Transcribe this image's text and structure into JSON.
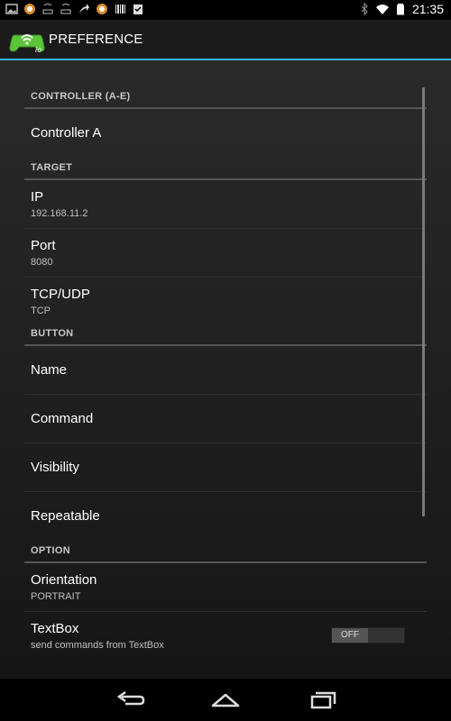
{
  "status_bar": {
    "time": "21:35",
    "icons_left": [
      "gallery-icon",
      "app-icon",
      "download-icon",
      "download-icon",
      "share-icon",
      "app-icon",
      "barcode-icon",
      "checklist-icon"
    ],
    "icons_right": [
      "bluetooth-icon",
      "wifi-icon",
      "battery-icon"
    ]
  },
  "action_bar": {
    "title": "PREFERENCE",
    "icon": "gamepad-icon",
    "accent_color": "#33b5e5"
  },
  "sections": [
    {
      "header": "CONTROLLER (A-E)",
      "items": [
        {
          "title": "Controller A",
          "summary": ""
        }
      ]
    },
    {
      "header": "TARGET",
      "items": [
        {
          "title": "IP",
          "summary": "192.168.11.2"
        },
        {
          "title": "Port",
          "summary": "8080"
        },
        {
          "title": "TCP/UDP",
          "summary": "TCP"
        }
      ]
    },
    {
      "header": "BUTTON",
      "items": [
        {
          "title": "Name",
          "summary": ""
        },
        {
          "title": "Command",
          "summary": ""
        },
        {
          "title": "Visibility",
          "summary": ""
        },
        {
          "title": "Repeatable",
          "summary": ""
        }
      ]
    },
    {
      "header": "OPTION",
      "items": [
        {
          "title": "Orientation",
          "summary": "PORTRAIT"
        },
        {
          "title": "TextBox",
          "summary": "send commands from TextBox",
          "toggle": "OFF"
        }
      ]
    }
  ],
  "nav_bar": {
    "back": "back-icon",
    "home": "home-icon",
    "recents": "recents-icon"
  }
}
